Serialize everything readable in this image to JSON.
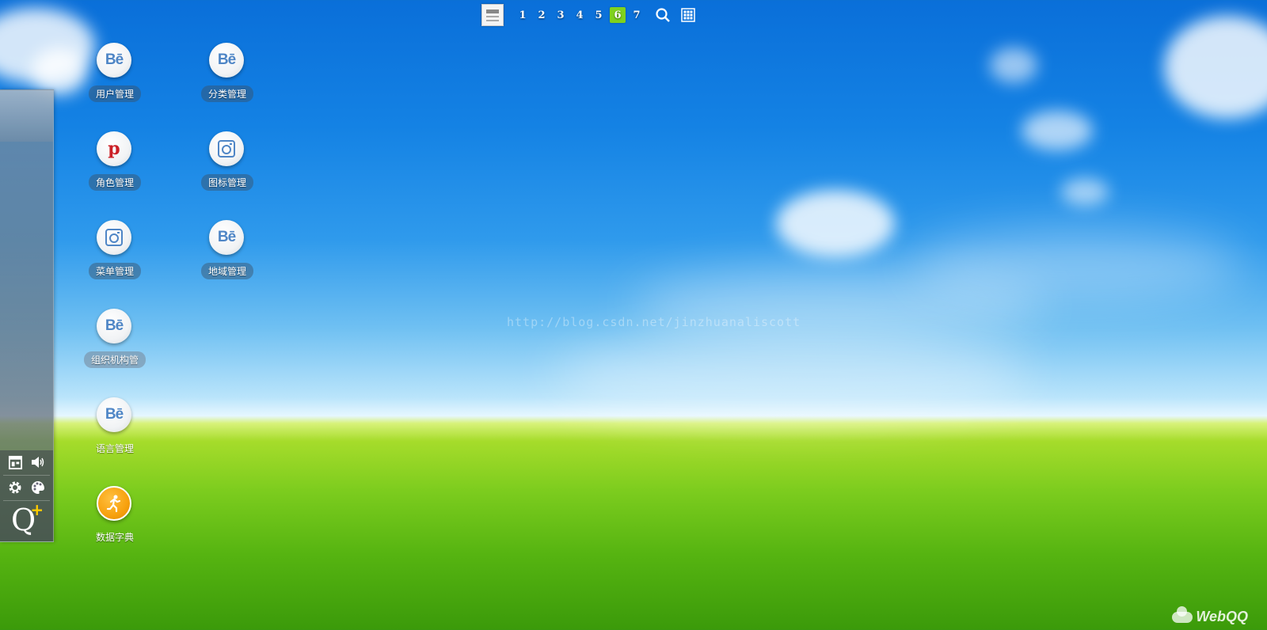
{
  "top_nav": {
    "desktops": [
      "1",
      "2",
      "3",
      "4",
      "5",
      "6",
      "7"
    ],
    "active_desktop": "6"
  },
  "apps": [
    {
      "id": "user-management",
      "label": "用户管理",
      "icon": "behance-icon"
    },
    {
      "id": "role-management",
      "label": "角色管理",
      "icon": "pinterest-icon"
    },
    {
      "id": "menu-management",
      "label": "菜单管理",
      "icon": "instagram-icon"
    },
    {
      "id": "org-management",
      "label": "组织机构管",
      "icon": "behance-icon"
    },
    {
      "id": "language-management",
      "label": "语言管理",
      "icon": "behance-icon"
    },
    {
      "id": "data-dictionary",
      "label": "数据字典",
      "icon": "runner-icon"
    },
    {
      "id": "category-management",
      "label": "分类管理",
      "icon": "behance-icon"
    },
    {
      "id": "icon-management",
      "label": "图标管理",
      "icon": "instagram-icon"
    },
    {
      "id": "region-management",
      "label": "地域管理",
      "icon": "behance-icon"
    }
  ],
  "icon_text": {
    "behance": "Bē"
  },
  "dock": {
    "q_letter": "Q",
    "q_plus": "+"
  },
  "watermark": "http://blog.csdn.net/jinzhuanaliscott",
  "brand": "WebQQ",
  "colors": {
    "active_page": "#7fd21e",
    "data_dictionary_icon": "#f7a10e",
    "behance_blue": "#4f86c6",
    "pinterest_red": "#cb2027"
  }
}
